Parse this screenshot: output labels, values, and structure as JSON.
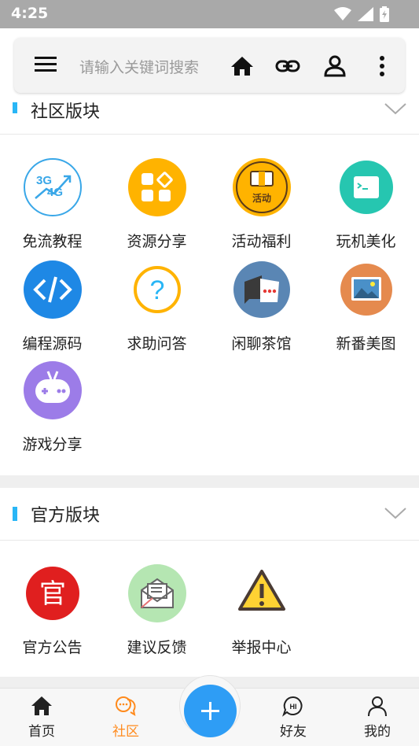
{
  "status": {
    "time": "4:25"
  },
  "search": {
    "placeholder": "请输入关键词搜索"
  },
  "community": {
    "title": "社区版块",
    "items": [
      {
        "label": "免流教程",
        "icon": "3g-4g-icon"
      },
      {
        "label": "资源分享",
        "icon": "resource-grid-icon"
      },
      {
        "label": "活动福利",
        "icon": "activity-gift-icon"
      },
      {
        "label": "玩机美化",
        "icon": "terminal-icon"
      },
      {
        "label": "编程源码",
        "icon": "code-icon"
      },
      {
        "label": "求助问答",
        "icon": "question-icon"
      },
      {
        "label": "闲聊茶馆",
        "icon": "chat-bubble-icon"
      },
      {
        "label": "新番美图",
        "icon": "picture-icon"
      },
      {
        "label": "游戏分享",
        "icon": "gamepad-icon"
      }
    ],
    "activity_badge_text": "活动"
  },
  "official": {
    "title": "官方版块",
    "items": [
      {
        "label": "官方公告",
        "icon": "official-announcement-icon",
        "glyph": "官"
      },
      {
        "label": "建议反馈",
        "icon": "mail-feedback-icon"
      },
      {
        "label": "举报中心",
        "icon": "warning-icon"
      }
    ]
  },
  "bottom_nav": {
    "home": "首页",
    "community": "社区",
    "friends": "好友",
    "me": "我的",
    "friends_badge": "HI"
  },
  "colors": {
    "accent": "#29b6f6",
    "active_tab": "#ff8a1c",
    "fab": "#2e9df5"
  }
}
